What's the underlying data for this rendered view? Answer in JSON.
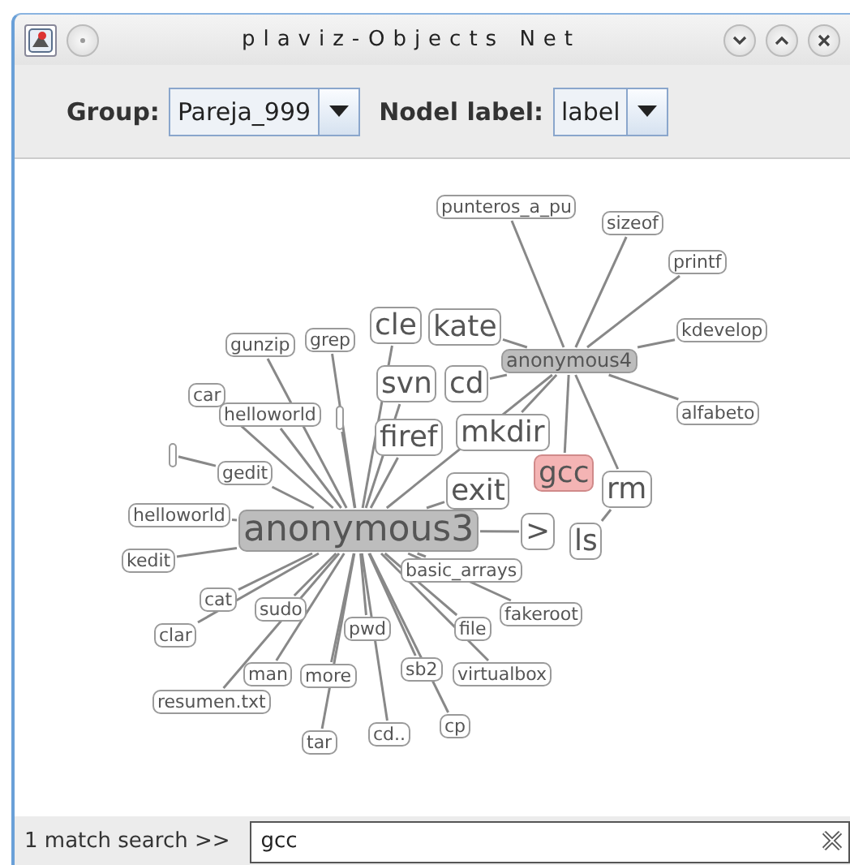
{
  "window": {
    "title": "plaviz-Objects Net"
  },
  "toolbar": {
    "group_label": "Group:",
    "group_value": "Pareja_999",
    "node_label_label": "Nodel label:",
    "node_label_value": "label"
  },
  "graph": {
    "root": {
      "label": "anonymous3",
      "kind": "center",
      "highlighted": false,
      "children": [
        {
          "label": "anonymous4",
          "kind": "hub",
          "highlighted": false,
          "children": [
            {
              "label": "punteros_a_pu",
              "kind": "small",
              "highlighted": false
            },
            {
              "label": "sizeof",
              "kind": "small",
              "highlighted": false
            },
            {
              "label": "printf",
              "kind": "small",
              "highlighted": false
            },
            {
              "label": "kate",
              "kind": "big",
              "highlighted": false
            },
            {
              "label": "kdevelop",
              "kind": "small",
              "highlighted": false
            },
            {
              "label": "cd",
              "kind": "big",
              "highlighted": false
            },
            {
              "label": "alfabeto",
              "kind": "small",
              "highlighted": false
            },
            {
              "label": "mkdir",
              "kind": "big",
              "highlighted": false
            },
            {
              "label": "gcc",
              "kind": "big",
              "highlighted": true
            },
            {
              "label": "rm",
              "kind": "big",
              "highlighted": false,
              "children": [
                {
                  "label": "ls",
                  "kind": "big",
                  "highlighted": false
                }
              ]
            }
          ]
        },
        {
          "label": "cle",
          "kind": "big",
          "highlighted": false
        },
        {
          "label": "grep",
          "kind": "small",
          "highlighted": false
        },
        {
          "label": "gunzip",
          "kind": "small",
          "highlighted": false
        },
        {
          "label": "svn",
          "kind": "big",
          "highlighted": false
        },
        {
          "label": "car",
          "kind": "small",
          "highlighted": false
        },
        {
          "label": "helloworld",
          "kind": "small",
          "highlighted": false
        },
        {
          "kind": "stub",
          "highlighted": false
        },
        {
          "label": "firef",
          "kind": "big",
          "highlighted": false
        },
        {
          "label": "gedit",
          "kind": "small",
          "highlighted": false,
          "children": [
            {
              "kind": "stub",
              "highlighted": false
            }
          ]
        },
        {
          "label": "exit",
          "kind": "big",
          "highlighted": false
        },
        {
          "label": ">",
          "kind": "big",
          "highlighted": false
        },
        {
          "label": "helloworld",
          "kind": "small",
          "highlighted": false
        },
        {
          "label": "kedit",
          "kind": "small",
          "highlighted": false
        },
        {
          "label": "basic_arrays",
          "kind": "small",
          "highlighted": false
        },
        {
          "label": "cat",
          "kind": "small",
          "highlighted": false
        },
        {
          "label": "sudo",
          "kind": "small",
          "highlighted": false
        },
        {
          "label": "fakeroot",
          "kind": "small",
          "highlighted": false
        },
        {
          "label": "clar",
          "kind": "small",
          "highlighted": false
        },
        {
          "label": "pwd",
          "kind": "small",
          "highlighted": false
        },
        {
          "label": "file",
          "kind": "small",
          "highlighted": false
        },
        {
          "label": "man",
          "kind": "small",
          "highlighted": false
        },
        {
          "label": "more",
          "kind": "small",
          "highlighted": false
        },
        {
          "label": "sb2",
          "kind": "small",
          "highlighted": false
        },
        {
          "label": "virtualbox",
          "kind": "small",
          "highlighted": false
        },
        {
          "label": "resumen.txt",
          "kind": "small",
          "highlighted": false
        },
        {
          "label": "tar",
          "kind": "small",
          "highlighted": false
        },
        {
          "label": "cd..",
          "kind": "small",
          "highlighted": false
        },
        {
          "label": "cp",
          "kind": "small",
          "highlighted": false
        }
      ]
    }
  },
  "search": {
    "status": "1 match search >>",
    "value": "gcc"
  }
}
